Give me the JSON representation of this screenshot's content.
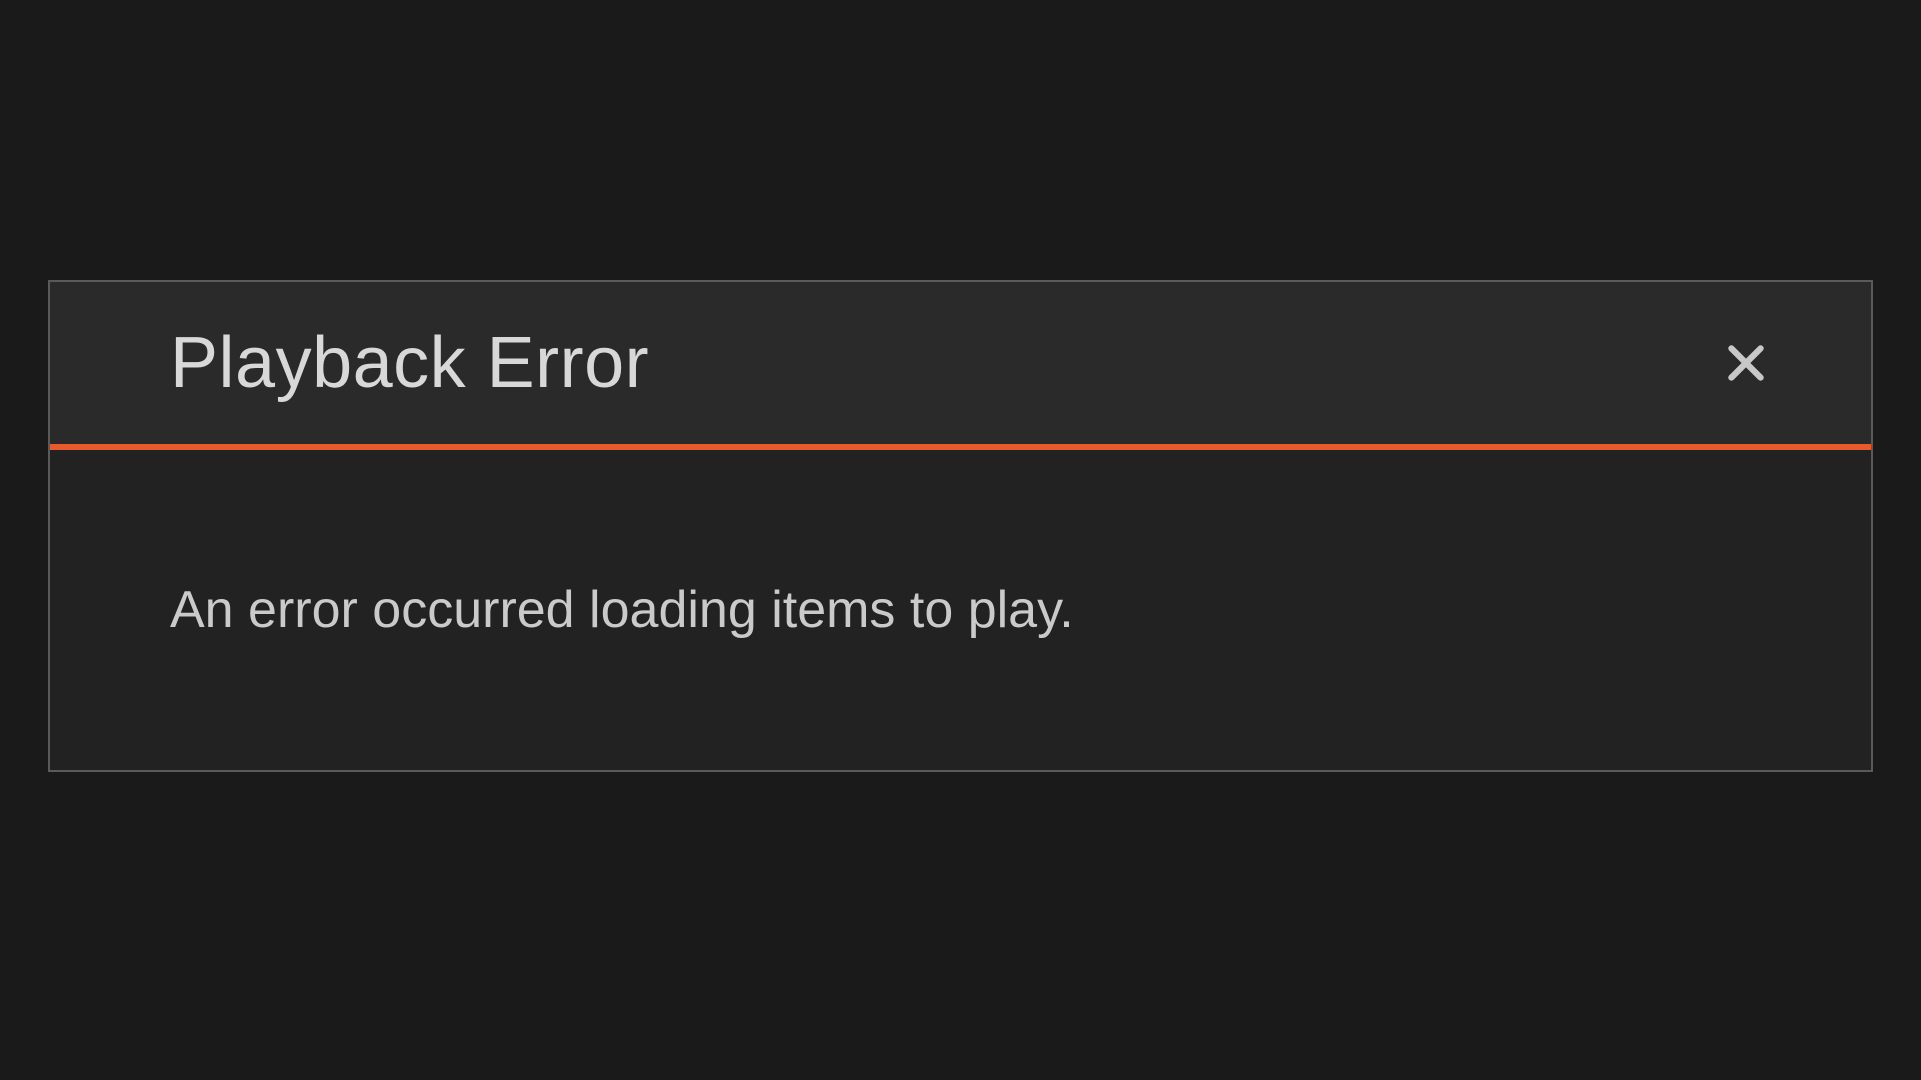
{
  "dialog": {
    "title": "Playback Error",
    "message": "An error occurred loading items to play.",
    "close_icon": "close-icon"
  },
  "colors": {
    "accent": "#e85a2c",
    "background": "#1a1a1a",
    "dialog_bg": "#252525",
    "text": "#d8d8d8"
  }
}
